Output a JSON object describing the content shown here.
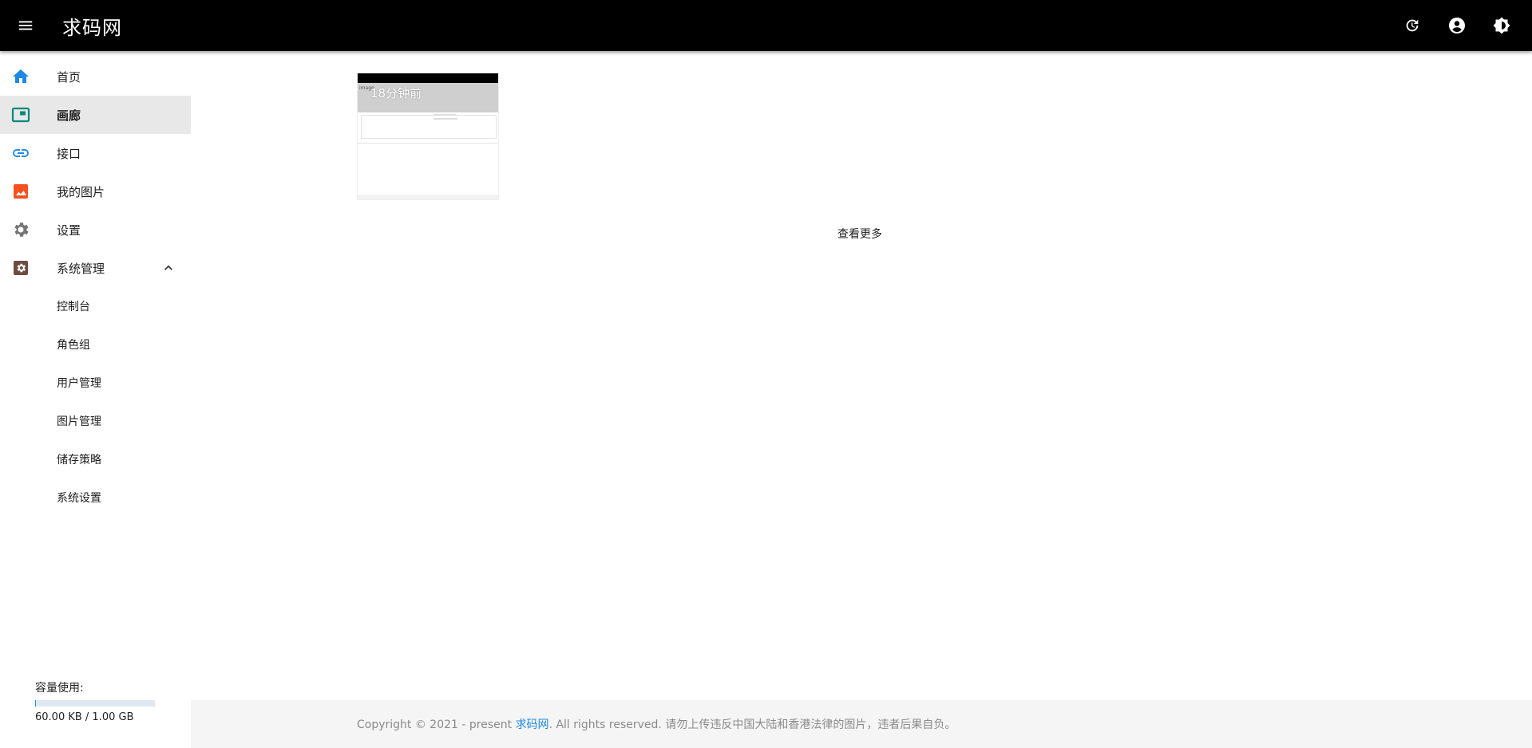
{
  "appbar": {
    "title": "求码网",
    "icons": [
      "menu-icon",
      "history-icon",
      "account-circle-icon",
      "brightness-icon"
    ]
  },
  "sidebar": {
    "items": [
      {
        "label": "首页",
        "icon": "home-icon",
        "color": "#1e88e5"
      },
      {
        "label": "画廊",
        "icon": "gallery-icon",
        "color": "#00897b",
        "active": true
      },
      {
        "label": "接口",
        "icon": "link-icon",
        "color": "#1e88e5"
      },
      {
        "label": "我的图片",
        "icon": "image-icon",
        "color": "#f4511e"
      },
      {
        "label": "设置",
        "icon": "gear-icon",
        "color": "#757575"
      },
      {
        "label": "系统管理",
        "icon": "admin-gear-icon",
        "color": "#6d4c41",
        "expanded": true
      }
    ],
    "sub_items": [
      "控制台",
      "角色组",
      "用户管理",
      "图片管理",
      "储存策略",
      "系统设置"
    ],
    "quota": {
      "label": "容量使用:",
      "value": "60.00 KB / 1.00 GB",
      "fraction": 6e-05
    }
  },
  "gallery": {
    "items": [
      {
        "time": "18分钟前",
        "thumb_text": "image"
      }
    ],
    "more_label": "查看更多"
  },
  "footer": {
    "prefix": "Copyright © 2021 - present ",
    "site_link": "求码网",
    "suffix": ". All rights reserved. 请勿上传违反中国大陆和香港法律的图片，违者后果自负。"
  },
  "colors": {
    "appbar": "#000000",
    "accent": "#1e88e5",
    "active_bg": "#e8e8e8",
    "footer_bg": "#f5f5f5"
  }
}
